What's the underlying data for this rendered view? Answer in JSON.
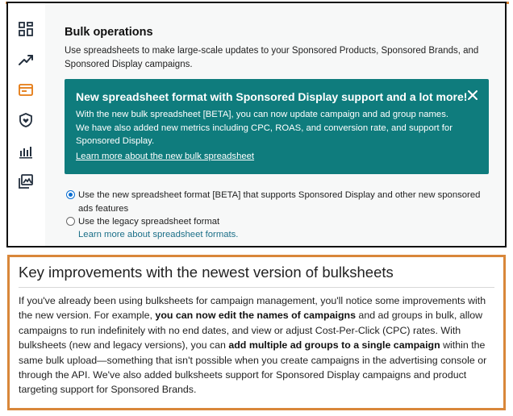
{
  "app": {
    "page_title": "Bulk operations",
    "page_description": "Use spreadsheets to make large-scale updates to your Sponsored Products, Sponsored Brands, and Sponsored Display campaigns."
  },
  "sidebar": {
    "items": [
      {
        "icon": "dashboard-grid-icon"
      },
      {
        "icon": "trend-chart-icon"
      },
      {
        "icon": "bulk-operations-icon",
        "active": true,
        "accent": "#e47911"
      },
      {
        "icon": "shield-heart-icon"
      },
      {
        "icon": "bar-chart-icon"
      },
      {
        "icon": "media-gallery-icon"
      }
    ]
  },
  "banner": {
    "title": "New spreadsheet format with Sponsored Display support and a lot more!",
    "body_line_1": "With the new bulk spreadsheet [BETA], you can now update campaign and ad group names.",
    "body_line_2": "We have also added new metrics including CPC, ROAS, and conversion rate, and support for Sponsored Display.",
    "link": "Learn more about the new bulk spreadsheet",
    "color": "#0f7c7d"
  },
  "format_options": [
    {
      "label": "Use the new spreadsheet format [BETA] that supports Sponsored Display and other new sponsored ads features",
      "selected": true
    },
    {
      "label": "Use the legacy spreadsheet format",
      "selected": false
    }
  ],
  "formats_link": "Learn more about spreadsheet formats.",
  "article": {
    "title": "Key improvements with the newest version of bulksheets",
    "p1": "If you've already been using bulksheets for campaign management, you'll notice some improvements with the new version. For example, ",
    "b1": "you can now edit the names of campaigns",
    "p2": " and ad groups in bulk, allow campaigns to run indefinitely with no end dates, and view or adjust Cost-Per-Click (CPC) rates. With bulksheets (new and legacy versions), you can ",
    "b2": "add multiple ad groups to a single campaign",
    "p3": " within the same bulk upload—something that isn't possible when you create campaigns in the advertising console or through the API. We've also added bulksheets support for Sponsored Display campaigns and product targeting support for Sponsored Brands.",
    "border_color": "#d9873a"
  }
}
